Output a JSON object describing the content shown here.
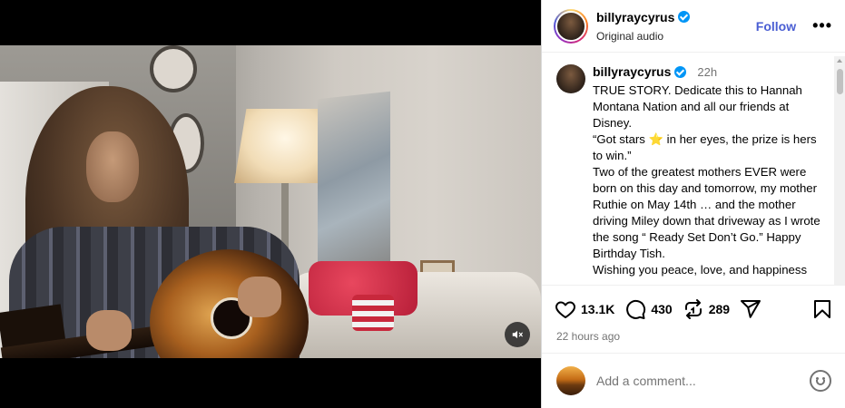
{
  "media": {
    "mute_icon": "speaker-muted-icon"
  },
  "header": {
    "username": "billyraycyrus",
    "verified_icon": "verified-badge-icon",
    "subtitle": "Original audio",
    "follow_label": "Follow",
    "more_label": "•••"
  },
  "caption": {
    "username": "billyraycyrus",
    "time": "22h",
    "text_1": "TRUE STORY. Dedicate this to Hannah Montana Nation and all our friends at Disney.\n“Got stars ",
    "star_emoji": "⭐",
    "text_2": " in her eyes, the prize is hers to win.”\nTwo of the greatest mothers EVER were born on this day and tomorrow, my mother Ruthie on May 14th … and the mother driving Miley down that driveway as I wrote the song “ Ready Set Don’t Go.” Happy Birthday Tish.\nWishing you peace, love, and happiness"
  },
  "actions": {
    "likes": "13.1K",
    "comments": "430",
    "reposts": "289",
    "posted_ago": "22 hours ago"
  },
  "add_comment": {
    "placeholder": "Add a comment..."
  }
}
